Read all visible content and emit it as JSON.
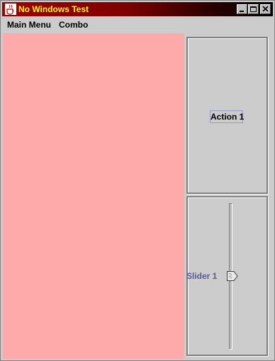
{
  "window": {
    "title": "No Windows Test",
    "controls": {
      "minimize_icon": "minimize-icon",
      "maximize_icon": "maximize-icon",
      "close_icon": "close-icon"
    }
  },
  "menubar": {
    "items": [
      {
        "label": "Main Menu"
      },
      {
        "label": "Combo"
      }
    ]
  },
  "panel_a": {
    "button_label": "Action 1"
  },
  "panel_b": {
    "slider_label": "Slider 1",
    "slider_value": 0.5
  },
  "colors": {
    "title_gradient_start": "#a00000",
    "title_text": "#ffff00",
    "canvas": "#ffaaaa",
    "label": "#5a5a9a"
  }
}
